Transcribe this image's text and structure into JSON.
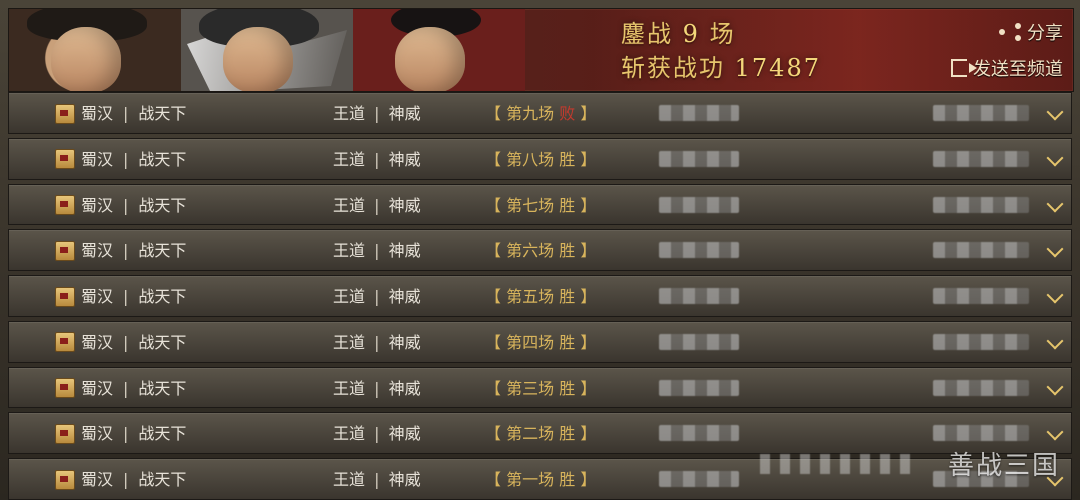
{
  "banner": {
    "line1_prefix": "鏖战",
    "battles": "9",
    "line1_suffix": "场",
    "line2_prefix": "斩获战功",
    "merit": "17487",
    "share_label": "分享",
    "send_label": "发送至频道"
  },
  "rows": [
    {
      "faction": "蜀汉",
      "mode": "战天下",
      "title1": "王道",
      "title2": "神威",
      "round": "第九场",
      "result": "败",
      "result_type": "loss"
    },
    {
      "faction": "蜀汉",
      "mode": "战天下",
      "title1": "王道",
      "title2": "神威",
      "round": "第八场",
      "result": "胜",
      "result_type": "win"
    },
    {
      "faction": "蜀汉",
      "mode": "战天下",
      "title1": "王道",
      "title2": "神威",
      "round": "第七场",
      "result": "胜",
      "result_type": "win"
    },
    {
      "faction": "蜀汉",
      "mode": "战天下",
      "title1": "王道",
      "title2": "神威",
      "round": "第六场",
      "result": "胜",
      "result_type": "win"
    },
    {
      "faction": "蜀汉",
      "mode": "战天下",
      "title1": "王道",
      "title2": "神威",
      "round": "第五场",
      "result": "胜",
      "result_type": "win"
    },
    {
      "faction": "蜀汉",
      "mode": "战天下",
      "title1": "王道",
      "title2": "神威",
      "round": "第四场",
      "result": "胜",
      "result_type": "win"
    },
    {
      "faction": "蜀汉",
      "mode": "战天下",
      "title1": "王道",
      "title2": "神威",
      "round": "第三场",
      "result": "胜",
      "result_type": "win"
    },
    {
      "faction": "蜀汉",
      "mode": "战天下",
      "title1": "王道",
      "title2": "神威",
      "round": "第二场",
      "result": "胜",
      "result_type": "win"
    },
    {
      "faction": "蜀汉",
      "mode": "战天下",
      "title1": "王道",
      "title2": "神威",
      "round": "第一场",
      "result": "胜",
      "result_type": "win"
    }
  ],
  "watermark": "善战三国",
  "icons": {
    "row_faction_icon": "scroll-seal-icon",
    "expand_icon": "chevron-down-icon",
    "share_icon": "share-icon",
    "send_icon": "send-to-channel-icon"
  },
  "colors": {
    "gold": "#e6c56c",
    "win": "#d8b45c",
    "loss": "#c23a2e",
    "banner_red": "#8a2a22"
  }
}
